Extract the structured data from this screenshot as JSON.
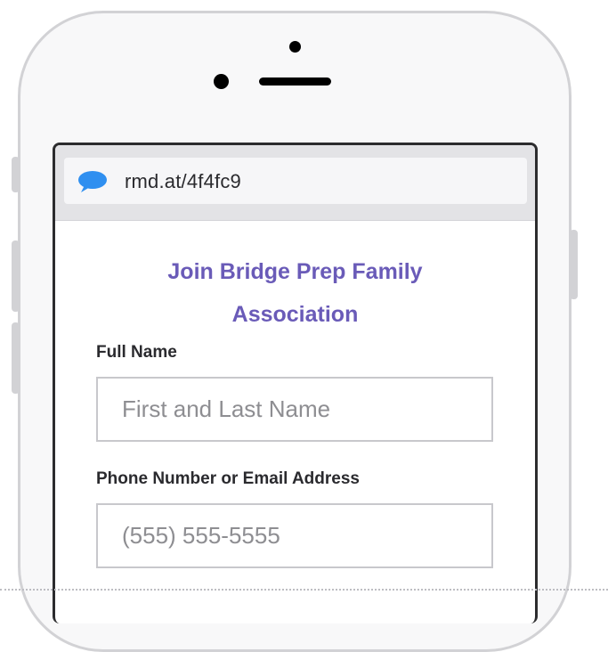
{
  "browser": {
    "url": "rmd.at/4f4fc9",
    "url_icon": "chat-bubble-icon"
  },
  "form": {
    "title_line1": "Join Bridge Prep Family",
    "title_line2": "Association",
    "full_name_label": "Full Name",
    "full_name_placeholder": "First and Last Name",
    "full_name_value": "",
    "contact_label": "Phone Number or Email Address",
    "contact_placeholder": "(555) 555-5555",
    "contact_value": ""
  },
  "colors": {
    "title": "#6a5bb8",
    "chat_icon": "#2f8ff0",
    "phone_frame": "#d2d2d5"
  }
}
